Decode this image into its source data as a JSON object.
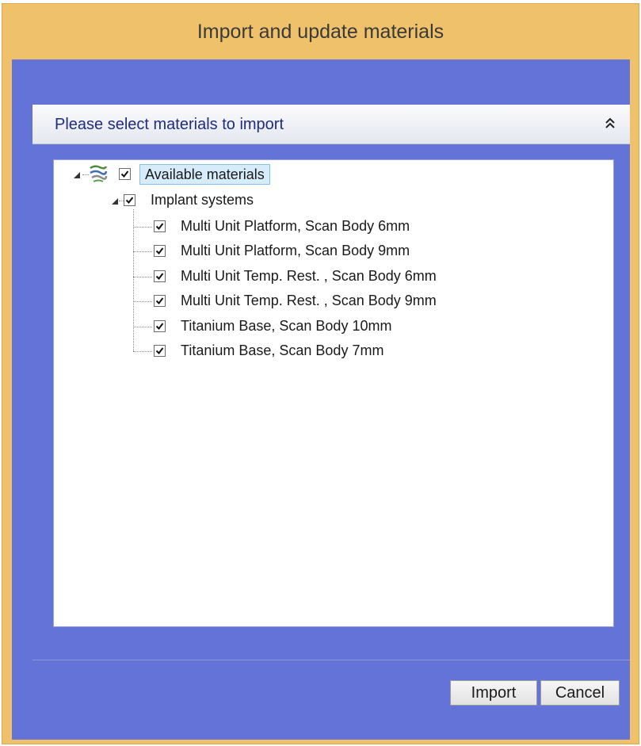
{
  "window": {
    "title": "Import and update materials"
  },
  "section": {
    "title": "Please select materials to import",
    "collapse_icon": "double-chevron-up-icon"
  },
  "tree": {
    "root": {
      "label": "Available materials",
      "icon": "materials-icon",
      "checked": true,
      "expanded": true
    },
    "group": {
      "label": "Implant systems",
      "checked": true,
      "expanded": true
    },
    "items": [
      {
        "label": "Multi Unit Platform, Scan Body 6mm",
        "checked": true
      },
      {
        "label": "Multi Unit Platform, Scan Body 9mm",
        "checked": true
      },
      {
        "label": "Multi Unit Temp. Rest. , Scan Body 6mm",
        "checked": true
      },
      {
        "label": "Multi Unit Temp. Rest. , Scan Body 9mm",
        "checked": true
      },
      {
        "label": "Titanium Base, Scan Body 10mm",
        "checked": true
      },
      {
        "label": "Titanium Base, Scan Body 7mm",
        "checked": true
      }
    ]
  },
  "buttons": {
    "import_label": "Import",
    "cancel_label": "Cancel"
  },
  "colors": {
    "title_bar": "#eec16a",
    "client_background": "#6373d8",
    "section_title": "#1e2d7e",
    "selection_fill": "#d7ecfa"
  }
}
